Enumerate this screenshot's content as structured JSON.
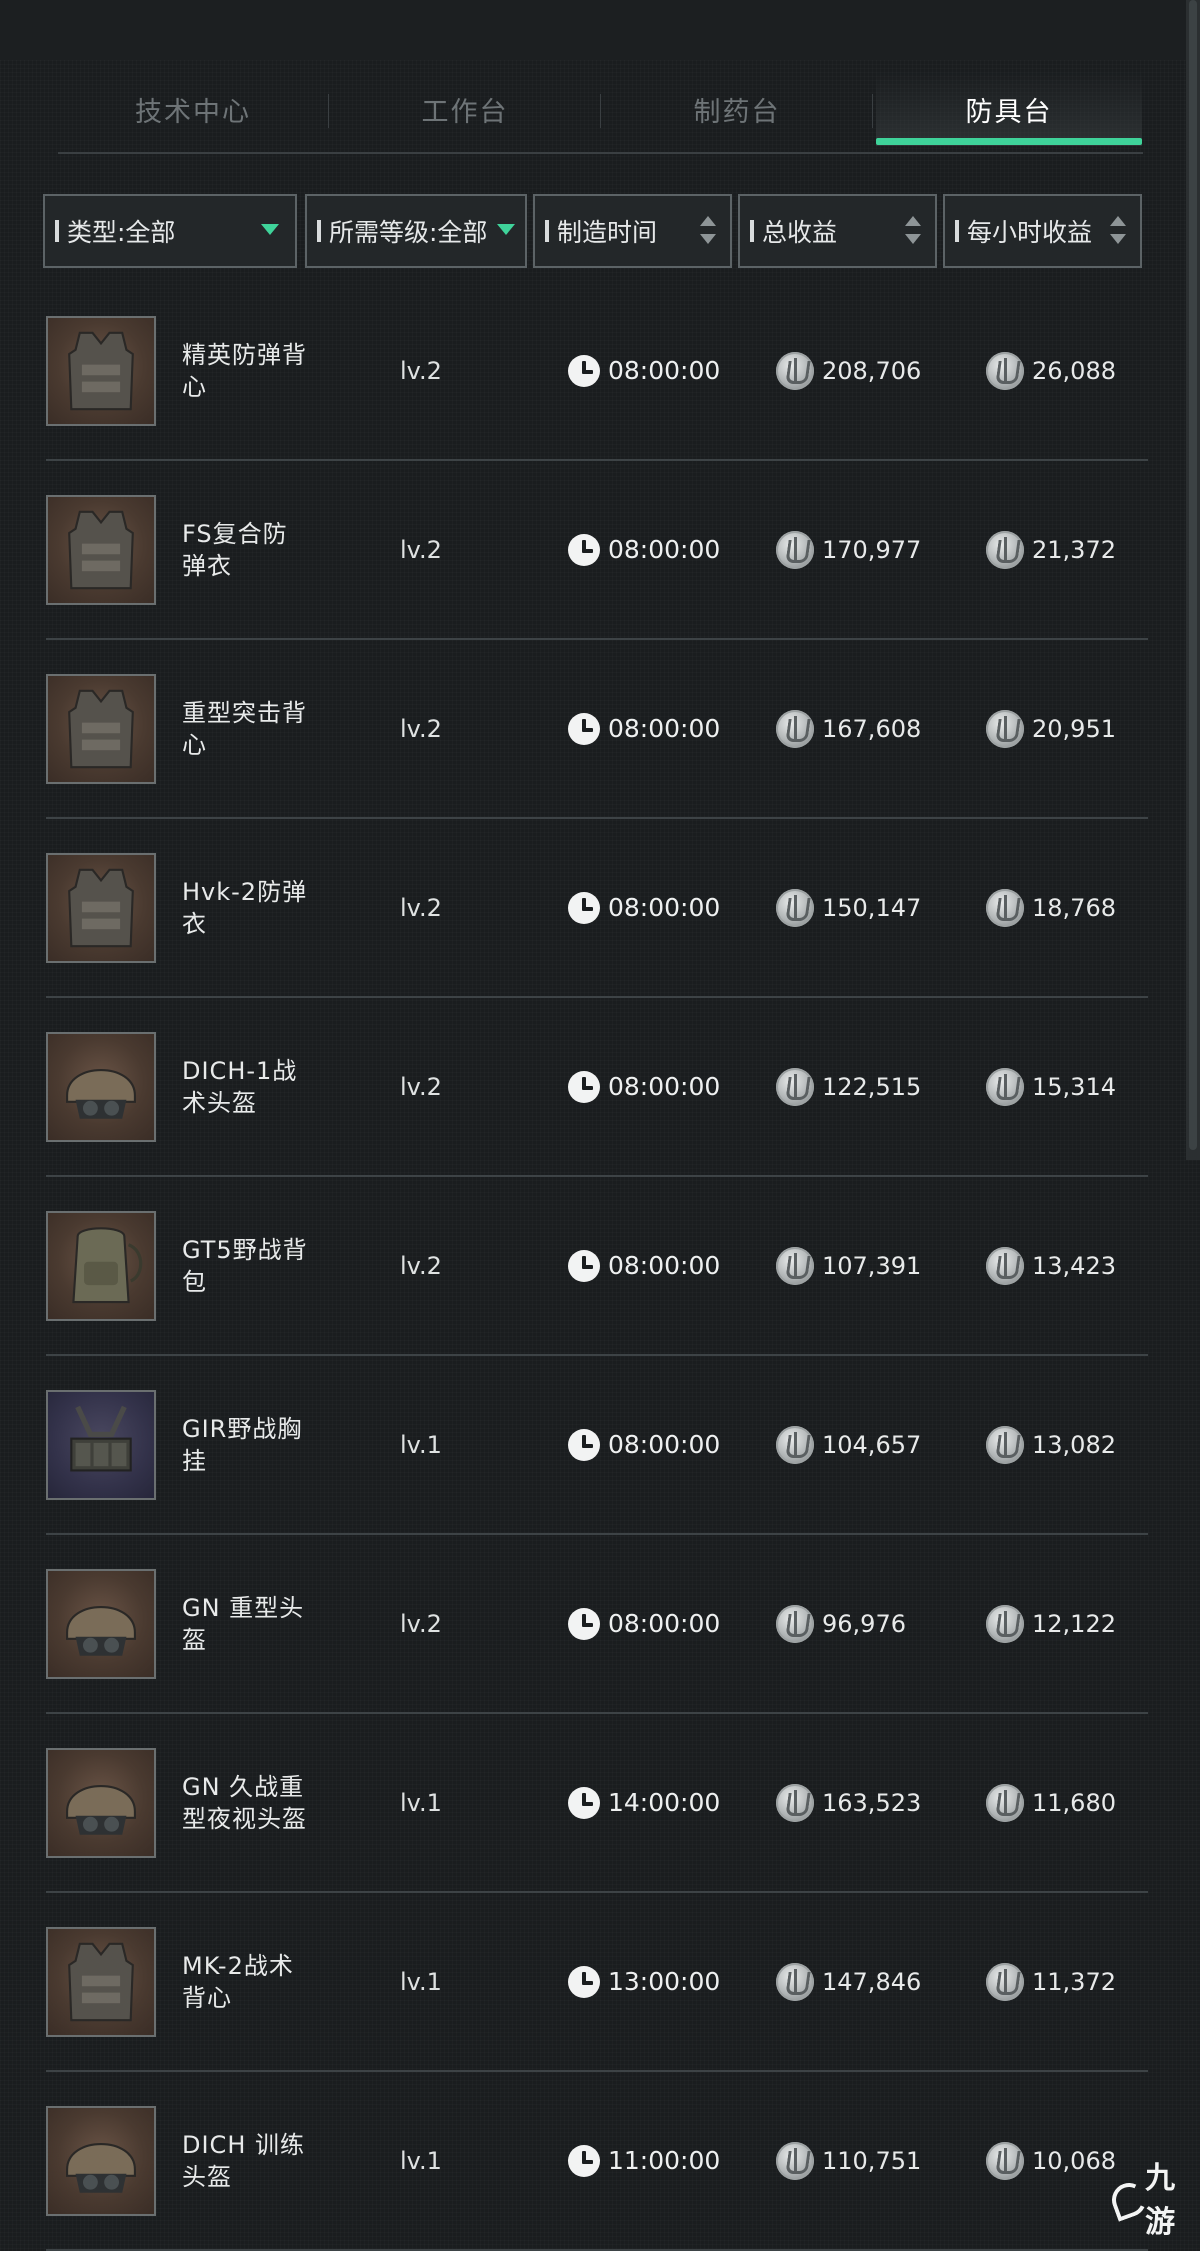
{
  "tabs": [
    {
      "label": "技术中心",
      "active": false
    },
    {
      "label": "工作台",
      "active": false
    },
    {
      "label": "制药台",
      "active": false
    },
    {
      "label": "防具台",
      "active": true
    }
  ],
  "filters": {
    "type": "类型:全部",
    "level": "所需等级:全部",
    "craft_time": "制造时间",
    "total_income": "总收益",
    "hourly_income": "每小时收益"
  },
  "items": [
    {
      "name": "精英防弹背心",
      "level": "lv.2",
      "time": "08:00:00",
      "total": "208,706",
      "hourly": "26,088",
      "icon": "vest-icon"
    },
    {
      "name": "FS复合防弹衣",
      "level": "lv.2",
      "time": "08:00:00",
      "total": "170,977",
      "hourly": "21,372",
      "icon": "vest-icon"
    },
    {
      "name": "重型突击背心",
      "level": "lv.2",
      "time": "08:00:00",
      "total": "167,608",
      "hourly": "20,951",
      "icon": "vest-icon"
    },
    {
      "name": "Hvk-2防弹衣",
      "level": "lv.2",
      "time": "08:00:00",
      "total": "150,147",
      "hourly": "18,768",
      "icon": "vest-icon"
    },
    {
      "name": "DICH-1战术头盔",
      "level": "lv.2",
      "time": "08:00:00",
      "total": "122,515",
      "hourly": "15,314",
      "icon": "helmet-icon"
    },
    {
      "name": "GT5野战背包",
      "level": "lv.2",
      "time": "08:00:00",
      "total": "107,391",
      "hourly": "13,423",
      "icon": "backpack-icon"
    },
    {
      "name": "GIR野战胸挂",
      "level": "lv.1",
      "time": "08:00:00",
      "total": "104,657",
      "hourly": "13,082",
      "icon": "chest-rig-icon"
    },
    {
      "name": "GN 重型头盔",
      "level": "lv.2",
      "time": "08:00:00",
      "total": "96,976",
      "hourly": "12,122",
      "icon": "helmet-icon"
    },
    {
      "name": "GN 久战重型夜视头盔",
      "level": "lv.1",
      "time": "14:00:00",
      "total": "163,523",
      "hourly": "11,680",
      "icon": "helmet-icon"
    },
    {
      "name": "MK-2战术背心",
      "level": "lv.1",
      "time": "13:00:00",
      "total": "147,846",
      "hourly": "11,372",
      "icon": "vest-icon"
    },
    {
      "name": "DICH 训练头盔",
      "level": "lv.1",
      "time": "11:00:00",
      "total": "110,751",
      "hourly": "10,068",
      "icon": "helmet-icon"
    }
  ],
  "watermark": "九游",
  "colors": {
    "accent": "#3fd39a",
    "background": "#1a1d1f"
  }
}
